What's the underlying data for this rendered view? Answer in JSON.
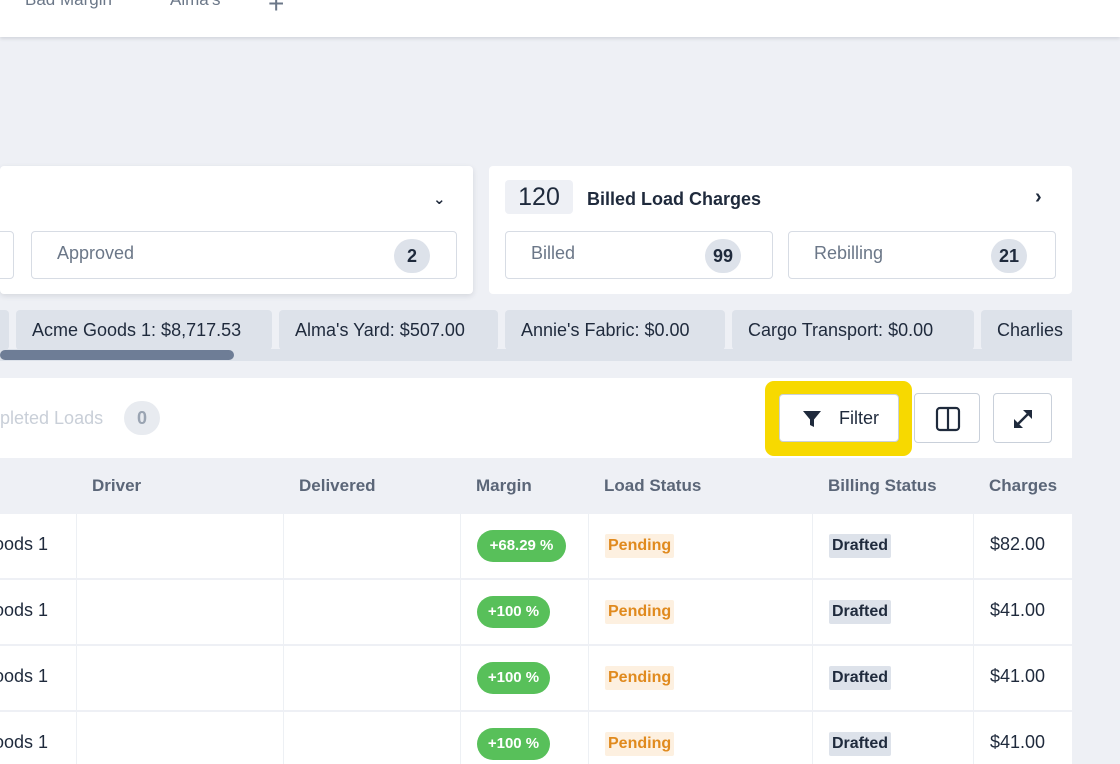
{
  "tabs": [
    {
      "label": "Bad Margin"
    },
    {
      "label": "Alma's"
    }
  ],
  "add_tab_icon": "plus-icon",
  "approval_card": {
    "partial_box_label": "",
    "approved": {
      "label": "Approved",
      "count": "2"
    }
  },
  "billed_card": {
    "count": "120",
    "title": "Billed Load Charges",
    "billed": {
      "label": "Billed",
      "count": "99"
    },
    "rebilling": {
      "label": "Rebilling",
      "count": "21"
    }
  },
  "customer_chips": [
    {
      "label": ""
    },
    {
      "label": "Acme Goods 1: $8,717.53"
    },
    {
      "label": "Alma's Yard: $507.00"
    },
    {
      "label": "Annie's Fabric: $0.00"
    },
    {
      "label": "Cargo Transport: $0.00"
    },
    {
      "label": "Charlies"
    }
  ],
  "toolbar": {
    "completed_label": "pleted Loads",
    "completed_count": "0",
    "filter_label": "Filter",
    "filter_icon": "funnel-icon",
    "columns_icon": "columns-icon",
    "expand_icon": "expand-icon",
    "highlight_color": "#f7d900"
  },
  "table": {
    "headers": {
      "driver": "Driver",
      "delivered": "Delivered",
      "margin": "Margin",
      "load_status": "Load Status",
      "billing_status": "Billing Status",
      "charges": "Charges"
    },
    "rows": [
      {
        "customer": "oods 1",
        "driver": "",
        "delivered": "",
        "margin": "+68.29 %",
        "load_status": "Pending",
        "billing_status": "Drafted",
        "charges": "$82.00"
      },
      {
        "customer": "oods 1",
        "driver": "",
        "delivered": "",
        "margin": "+100 %",
        "load_status": "Pending",
        "billing_status": "Drafted",
        "charges": "$41.00"
      },
      {
        "customer": "oods 1",
        "driver": "",
        "delivered": "",
        "margin": "+100 %",
        "load_status": "Pending",
        "billing_status": "Drafted",
        "charges": "$41.00"
      },
      {
        "customer": "oods 1",
        "driver": "",
        "delivered": "",
        "margin": "+100 %",
        "load_status": "Pending",
        "billing_status": "Drafted",
        "charges": "$41.00"
      }
    ]
  },
  "colors": {
    "margin_positive": "#58c05a",
    "pending_text": "#e08a1e",
    "pending_bg": "#fdf0e0",
    "drafted_bg": "#dde2ea",
    "scroll_thumb": "#6e7d96"
  }
}
